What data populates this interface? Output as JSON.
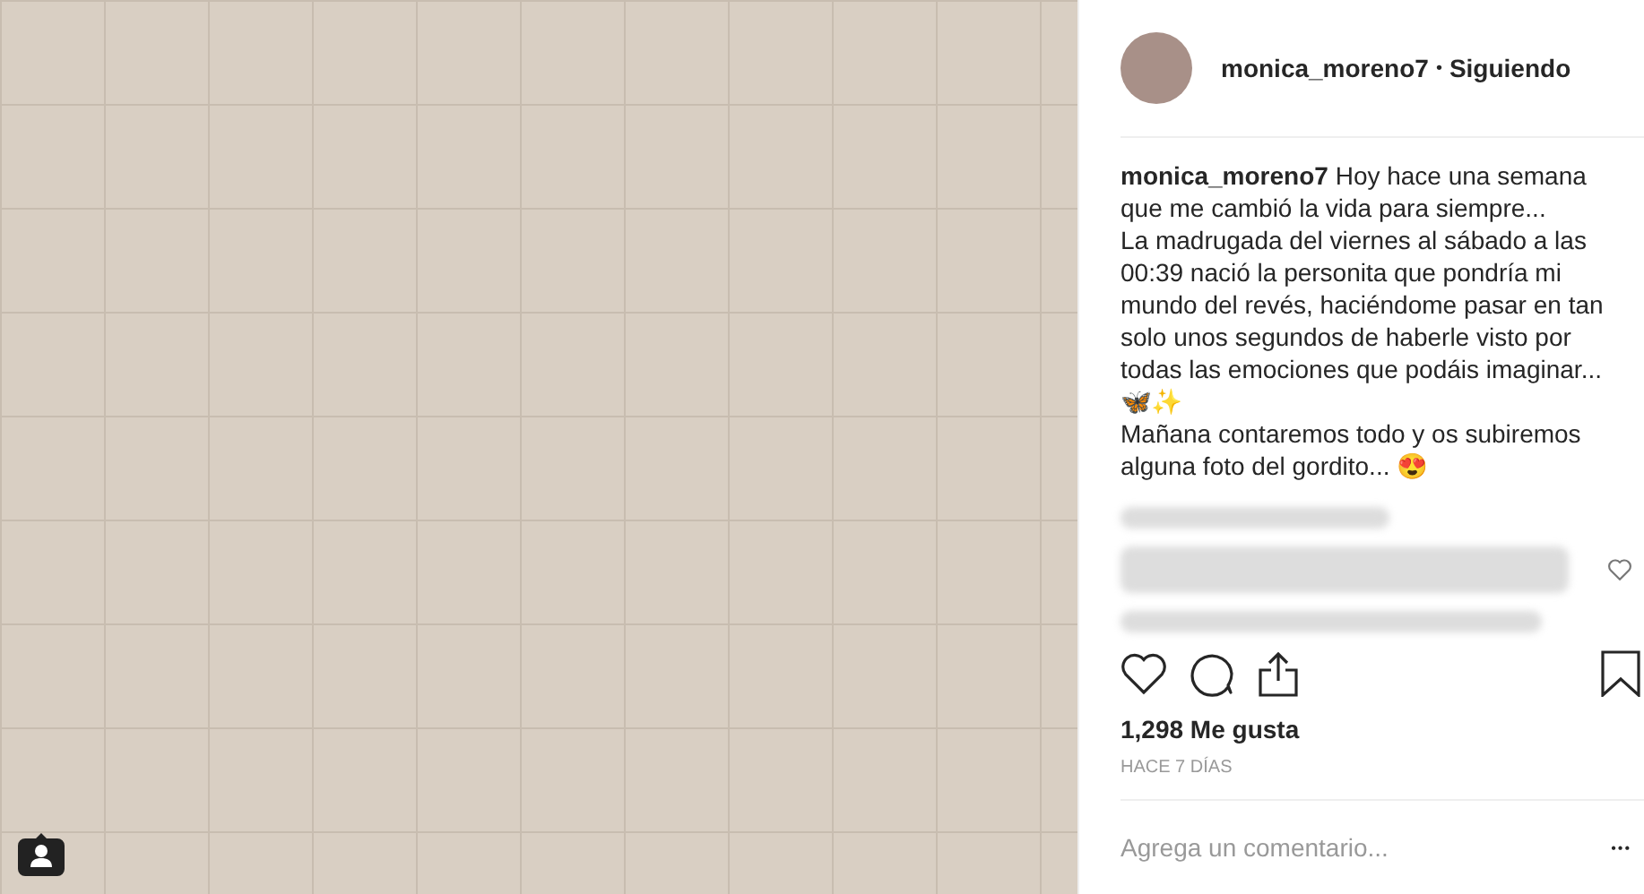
{
  "post": {
    "username": "monica_moreno7",
    "separator": "•",
    "follow_status": "Siguiendo"
  },
  "caption": {
    "username": "monica_moreno7",
    "paragraphs": [
      "Hoy hace una semana que me cambió la vida para siempre...",
      "La madrugada del viernes al sábado a las 00:39 nació la personita que pondría mi mundo del revés, haciéndome pasar en tan solo unos segundos de haberle visto por todas las emociones que podáis imaginar... 🦋✨",
      "Mañana contaremos todo y os subiremos alguna foto del gordito... 😍"
    ]
  },
  "likes": "1,298 Me gusta",
  "date": "HACE 7 DÍAS",
  "comment_field": {
    "placeholder": "Agrega un comentario..."
  },
  "more": "•••"
}
